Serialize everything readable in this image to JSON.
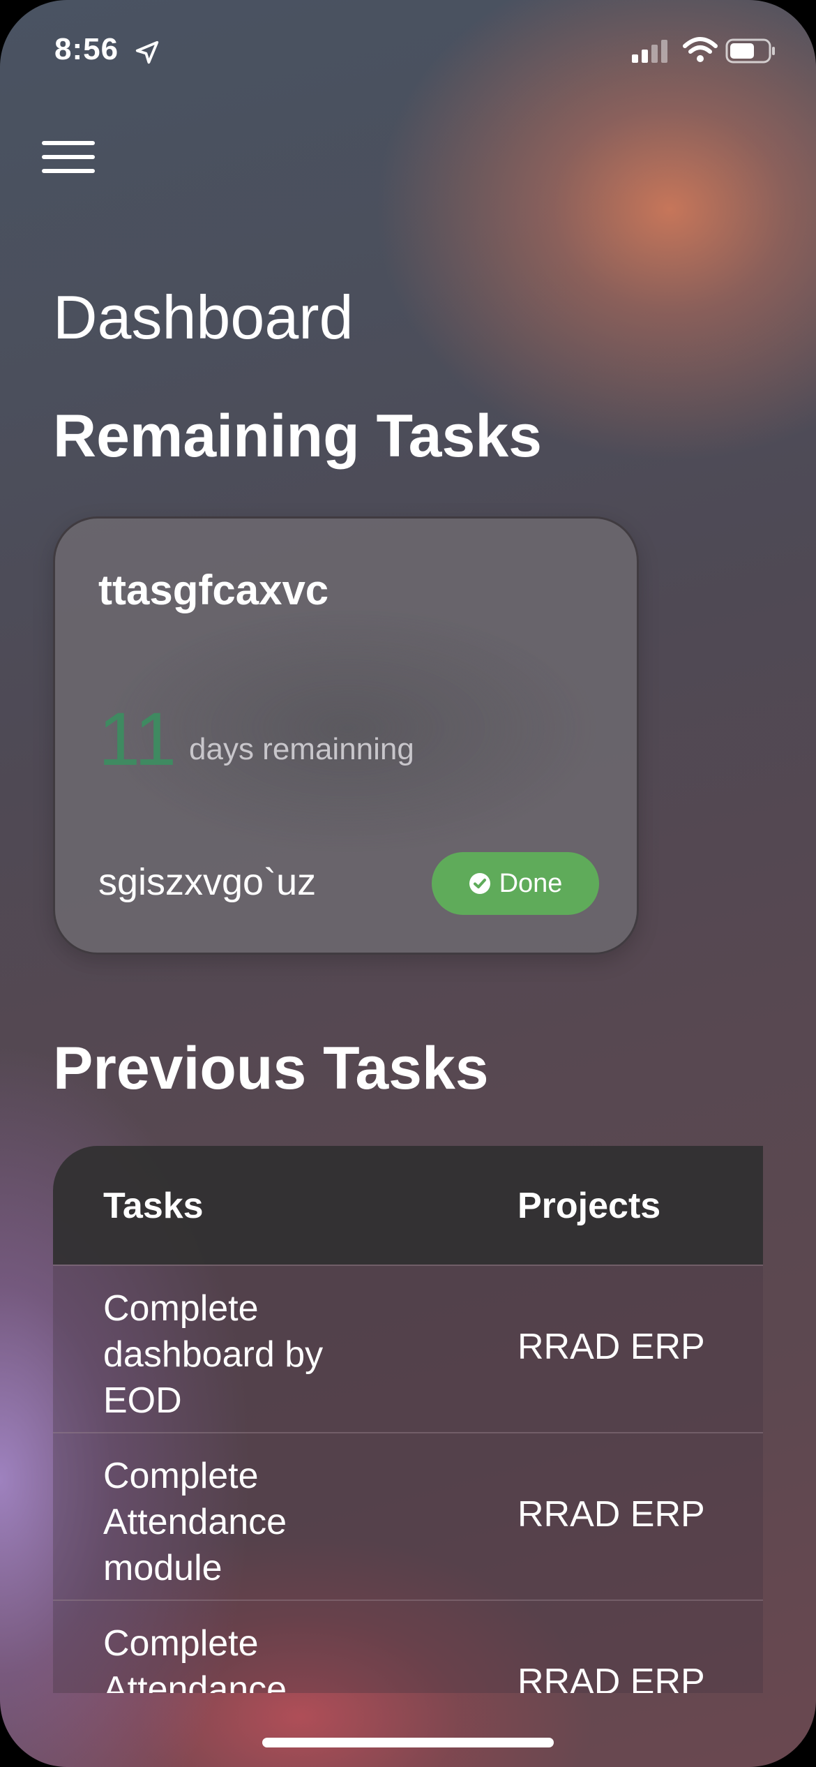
{
  "status_bar": {
    "time": "8:56",
    "icons": [
      "location-arrow-icon",
      "cellular-signal-icon",
      "wifi-icon",
      "battery-icon"
    ]
  },
  "header": {
    "menu_icon": "hamburger-menu-icon",
    "title": "Dashboard"
  },
  "remaining": {
    "section_title": "Remaining Tasks",
    "card": {
      "title": "ttasgfcaxvc",
      "days": "11",
      "days_label": "days remainning",
      "project": "sgiszxvgo`uz",
      "done_label": "Done",
      "done_icon": "check-circle-icon"
    }
  },
  "previous": {
    "section_title": "Previous Tasks",
    "columns": [
      "Tasks",
      "Projects"
    ],
    "rows": [
      {
        "task": "Complete dashboard by EOD",
        "project": "RRAD ERP"
      },
      {
        "task": "Complete Attendance module",
        "project": "RRAD ERP"
      },
      {
        "task": "Complete Attendance",
        "project": "RRAD ERP"
      }
    ]
  },
  "colors": {
    "days_accent": "#3f8a61",
    "done_button": "#5fab5a",
    "table_header": "#323032"
  }
}
